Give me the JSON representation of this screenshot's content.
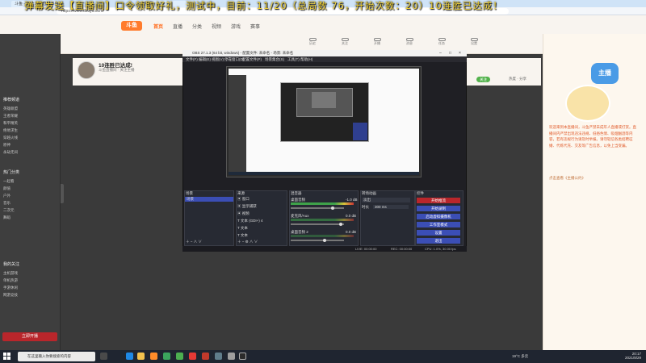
{
  "overlay_text": "弹幕发送【直播间】口令领取好礼，测试中，目前：11/20（总局数 76，开始次数：20）10连胜已达成！",
  "browser": {
    "tabs": [
      "斗鱼 - 每个人的直播平台",
      "直播间"
    ],
    "url": "https://www.douyu.com/"
  },
  "site": {
    "logo": "斗鱼",
    "nav": [
      "首页",
      "直播",
      "分类",
      "视频",
      "游戏",
      "赛事"
    ],
    "icons": [
      "历史",
      "关注",
      "开播",
      "消息",
      "任务",
      "设置"
    ]
  },
  "sidebar": {
    "sections": [
      {
        "title": "推荐频道",
        "items": [
          "英雄联盟",
          "王者荣耀",
          "和平精英",
          "绝地求生",
          "穿越火线",
          "原神",
          "永劫无间"
        ]
      },
      {
        "title": "热门分类",
        "items": [
          "一起看",
          "颜值",
          "户外",
          "音乐",
          "二次元",
          "舞蹈"
        ]
      },
      {
        "title": "我的关注",
        "items": [
          "主机游戏",
          "单机热游",
          "手游休闲",
          "网游竞技"
        ]
      }
    ],
    "cta": "立即开播"
  },
  "streamer": {
    "name": "10连胜已达成!",
    "sub": "斗鱼直播间 · 关注主播",
    "fans_label": "关注",
    "stat": "热度 · 分享"
  },
  "obs": {
    "title": "OBS 27.1.3 (64 bit, windows) - 配置文件: 未命名 - 场景: 未命名",
    "menu": [
      "文件(F)",
      "编辑(E)",
      "视图(V)",
      "停靠窗口(D)",
      "配置文件(P)",
      "场景集合(S)",
      "工具(T)",
      "帮助(H)"
    ],
    "docks": {
      "scenes": {
        "title": "场景",
        "items": [
          "场景"
        ]
      },
      "sources": {
        "title": "来源",
        "items": [
          "窗口",
          "显示捕获",
          "视频",
          "文本 (GDI+) 4",
          "文本",
          "文本"
        ]
      },
      "mixer": {
        "title": "混音器",
        "channels": [
          {
            "name": "桌面音频",
            "db": "-1.0 dB"
          },
          {
            "name": "麦克风/Aux",
            "db": "0.0 dB"
          },
          {
            "name": "桌面音频 2",
            "db": "0.0 dB"
          }
        ]
      },
      "transitions": {
        "title": "转场动画",
        "type": "淡出",
        "duration_label": "时长",
        "duration": "300 ms"
      },
      "controls": {
        "title": "控件",
        "buttons": [
          "开始推流",
          "开始录制",
          "启动虚拟摄像机",
          "工作室模式",
          "设置",
          "退出"
        ]
      }
    },
    "status": {
      "live": "LIVE: 00:00:00",
      "rec": "REC: 00:00:00",
      "cpu": "CPU: 1.0%, 30.00 fps"
    }
  },
  "chat": {
    "badge": "主播",
    "notice": "欢迎来到本直播间，斗鱼严禁未成年人直播或打赏。直播间内严禁出现违法违规、低俗色情、吸烟酗酒等内容，若有违规行为请及时举报。请勿轻信各类招聘征婚、代练代充、交友等广告信息，以免上当受骗。",
    "link": "点击查看《主播公约》"
  },
  "taskbar": {
    "search_placeholder": "在这里输入你要搜索的内容",
    "weather": "19°C 多云",
    "time": "20:17",
    "date": "2021/8/29"
  },
  "colors": {
    "brand": "#ff7b2c",
    "obs_selection": "#3b4eb5",
    "stream_button": "#b9262b",
    "overlay": "#f2d338"
  }
}
